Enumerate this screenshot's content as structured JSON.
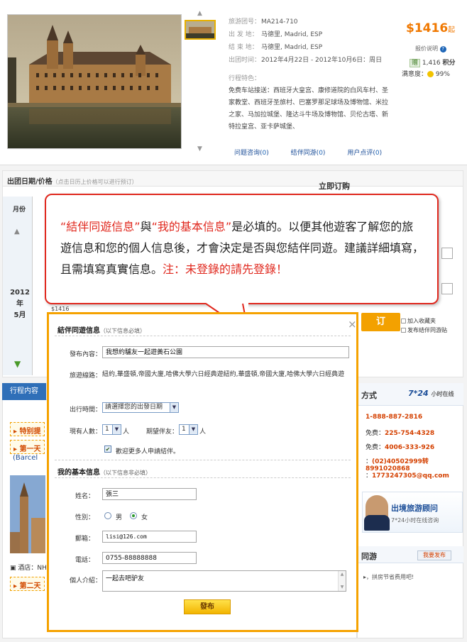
{
  "product": {
    "code_label": "旅游团号：",
    "code": "MA214-710",
    "depart_label": "出 发 地：",
    "depart": "马德里, Madrid, ESP",
    "end_label": "结 束 地：",
    "end": "马德里, Madrid, ESP",
    "time_label": "出团时间：",
    "time": "2012年4月22日 - 2012年10月6日：周日",
    "feature_title": "行程特色：",
    "feature_text": "免费车站接送：西班牙大皇宫、康修道院的白风车村、圣家教堂、西班牙圣旅村、巴塞罗那足球场及博物馆、米拉之家、马加拉城堡、隆达斗牛场及博物馆、贝伦古塔、新特拉皇宫、亚卡萨城堡、",
    "price": "$1416",
    "price_suffix": "起",
    "price_note": "报价说明",
    "reward_tag": "赠",
    "reward_value": "1,416",
    "reward_unit": "积分",
    "satisfaction_label": "满意度：",
    "satisfaction_value": "99%",
    "tab_qa": "问题咨询",
    "tab_qa_count": "0",
    "tab_companion": "结伴同游",
    "tab_companion_count": "0",
    "tab_review": "用户点评",
    "tab_review_count": "0"
  },
  "booking": {
    "title": "出团日期/价格",
    "hint": "（点击日历上价格可以进行预订）",
    "right_title": "立即订购",
    "month_col": "月份",
    "year": "2012年",
    "month": "5月",
    "cell_price": "$1416",
    "book_button": "订",
    "link_fav": "加入收藏夹",
    "link_publish": "发布结伴同游贴"
  },
  "lower": {
    "tab": "行程内容",
    "tag_special": "特别提",
    "tag_day1": "第一天",
    "city": "(Barcel",
    "hotel_label": "酒店：NH",
    "tag_day2": "第二天",
    "contact_title": "方式",
    "contact_hours": "7*24",
    "contact_hours_unit": "小时在线",
    "phones": [
      "1-888-887-2816",
      "225-754-4328",
      "4006-333-926",
      "(02)40502999转8991020868",
      "1773247305@qq.com"
    ],
    "phone_prefixes": [
      "",
      "免费：",
      "免费：",
      "：",
      "："
    ],
    "advisor_title": "出境旅游顾问",
    "advisor_sub": "7*24小时在线咨询",
    "companion_title": "同游",
    "publish_small": "我要发布",
    "companion_line": "，拼房节省费用吧!"
  },
  "callout": {
    "q1": "“結伴同遊信息”",
    "and": "與",
    "q2": "“我的基本信息”",
    "body": "是必填的。以便其他遊客了解您的旅遊信息和您的個人信息後，才會決定是否與您結伴同遊。建議詳細填寫，且需填寫真實信息。",
    "note": "注：未登錄的請先登錄！"
  },
  "modal": {
    "section1_title": "結伴同遊信息",
    "section1_hint": "（以下信息必填）",
    "content_label": "發布內容：",
    "content_value": "我想約驢友一起遊黃石公園",
    "route_label": "旅遊線路：",
    "route_value": "紐約,華盛頓,帝國大廈,哈佛大學六日經典遊紐約,華盛頓,帝國大廈,哈佛大學六日經典遊",
    "date_label": "出行時間：",
    "date_select": "請選擇您的出發日期",
    "people_label": "現有人數：",
    "people_value": "1",
    "people_unit": "人",
    "partner_label": "期望伴友：",
    "partner_value": "1",
    "partner_unit": "人",
    "welcome_check": "歡迎更多人申請結伴。",
    "section2_title": "我的基本信息",
    "section2_hint": "（以下信息非必填）",
    "name_label": "姓名：",
    "name_value": "張三",
    "gender_label": "性別：",
    "gender_male": "男",
    "gender_female": "女",
    "email_label": "郵箱：",
    "email_value": "lisi@126.com",
    "phone_label": "電話：",
    "phone_value": "0755-88888888",
    "intro_label": "個人介紹：",
    "intro_value": "一起去吧驴友",
    "submit": "發布",
    "close": "×"
  }
}
